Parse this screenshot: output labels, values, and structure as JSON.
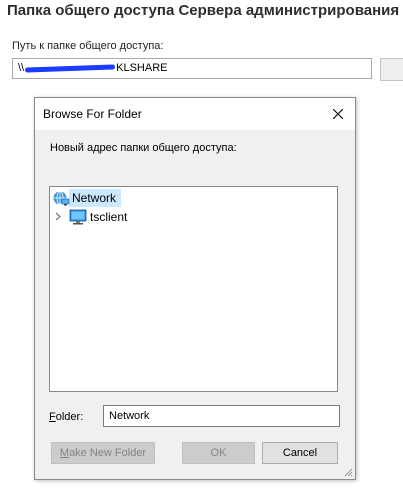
{
  "page": {
    "heading": "Папка общего доступа Сервера администрирования",
    "path_label": "Путь к папке общего доступа:",
    "path_prefix": "\\\\",
    "path_suffix": "KLSHARE"
  },
  "dialog": {
    "title": "Browse For Folder",
    "close_icon": "close-icon",
    "instruction": "Новый адрес папки общего доступа:",
    "tree": [
      {
        "label": "Network",
        "icon": "network-icon",
        "selected": true
      },
      {
        "label": "tsclient",
        "icon": "computer-icon",
        "expandable": true
      }
    ],
    "folder_label_prefix": "F",
    "folder_label_rest": "older:",
    "folder_value": "Network",
    "buttons": {
      "make_new_folder_prefix": "M",
      "make_new_folder_rest": "ake New Folder",
      "ok": "OK",
      "cancel": "Cancel"
    }
  },
  "colors": {
    "selection": "#cce8ff",
    "dialog_bg": "#f0f0f0",
    "redaction": "#1b3bff"
  }
}
